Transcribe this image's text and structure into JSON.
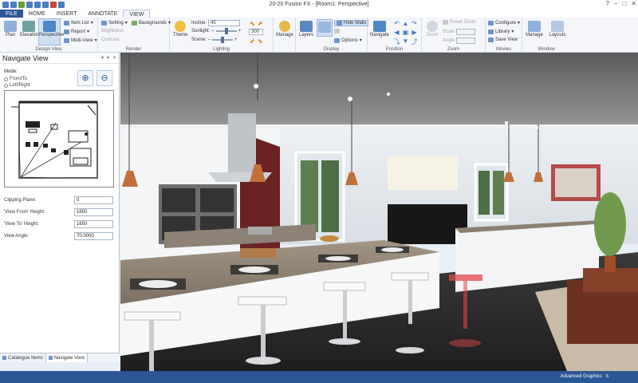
{
  "app": {
    "title": "20-20 Fusion FX - [Room1: Perspective]",
    "controls": [
      "?",
      "–",
      "□",
      "✕"
    ]
  },
  "tabs": [
    "FILE",
    "HOME",
    "INSERT",
    "ANNOTATE",
    "VIEW"
  ],
  "active_tab": "VIEW",
  "ribbon": {
    "design_view": {
      "label": "Design View",
      "plan": "Plan",
      "elevation": "Elevation",
      "perspective": "Perspective",
      "item_list": "Item List",
      "report": "Report",
      "multi_view": "Multi-View"
    },
    "render": {
      "label": "Render",
      "setting": "Setting",
      "backgrounds": "Backgrounds",
      "brightness": "Brightness",
      "contrast": "Contrast"
    },
    "lighting": {
      "label": "Lighting",
      "theme": "Theme",
      "incline_label": "Incline:",
      "incline_value": "45",
      "sunlight_label": "Sunlight:",
      "scene_label": "Scene:",
      "angle_value": "300"
    },
    "manage": {
      "label": "Manage"
    },
    "display": {
      "label": "Display",
      "layers": "Layers",
      "hide_walls": "Hide Walls",
      "options": "Options"
    },
    "position": {
      "label": "Position",
      "navigate": "Navigate"
    },
    "zoom": {
      "label": "Zoom",
      "zoom": "Zoom",
      "reset_zoom": "Reset Zoom",
      "scale_label": "Scale",
      "angle_label": "Angle"
    },
    "movies": {
      "label": "Movies",
      "configure": "Configure",
      "library": "Library",
      "save_view": "Save View"
    },
    "window": {
      "label": "Window",
      "manage": "Manage",
      "layouts": "Layouts"
    }
  },
  "navigate_panel": {
    "title": "Navigate View",
    "ctrls": [
      "▾",
      "▾",
      "✕"
    ],
    "mode_label": "Mode:",
    "mode_from_to": "From/To",
    "mode_left_right": "Left/Right",
    "clipping_label": "Clipping Plane:",
    "clipping_value": "0",
    "from_height_label": "'View From' Height:",
    "from_height_value": "1650",
    "to_height_label": "'View To' Height:",
    "to_height_value": "1650",
    "angle_label": "View Angle:",
    "angle_value": "70.0000"
  },
  "bottom_tabs": [
    "Catalogue Items",
    "Navigate View"
  ],
  "status": {
    "graphics": "Advanced Graphics",
    "indicator": "s"
  },
  "colors": {
    "brand": "#2b5797",
    "ribbon": "#f4f6fa"
  }
}
